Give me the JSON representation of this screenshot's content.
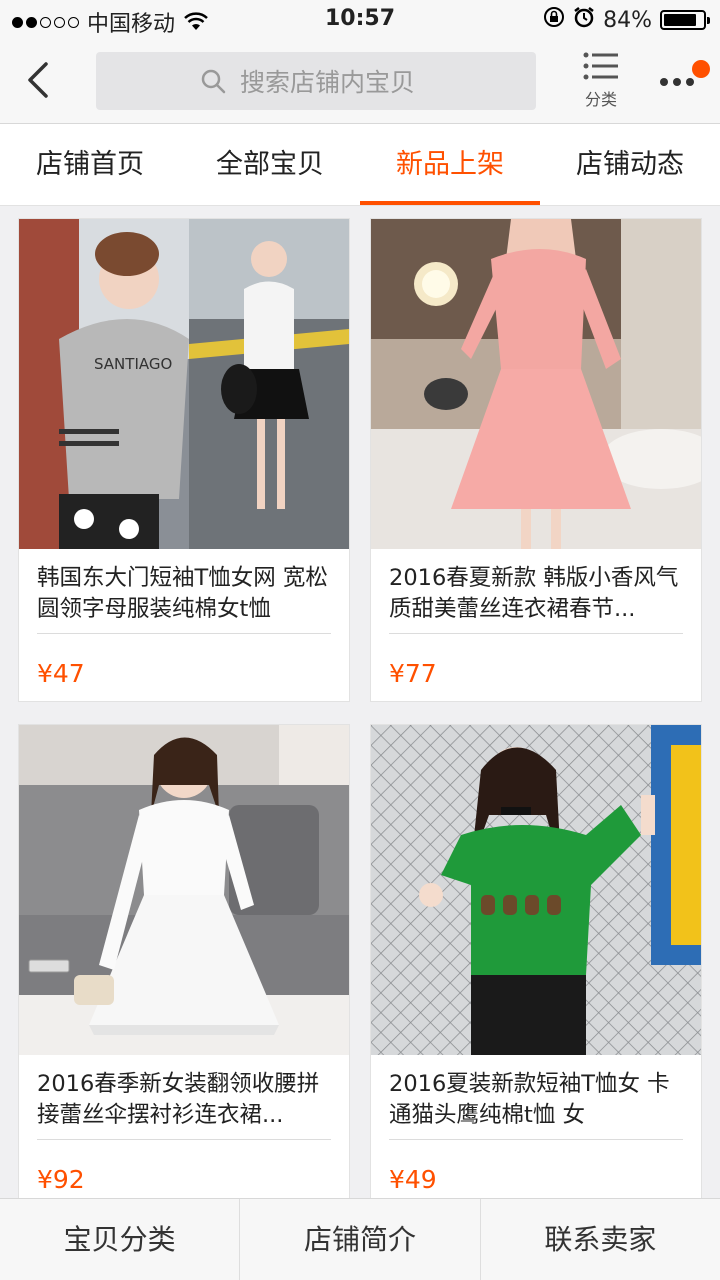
{
  "status_bar": {
    "carrier": "中国移动",
    "time": "10:57",
    "battery_percent": "84%",
    "battery_level": 0.84
  },
  "nav": {
    "search_placeholder": "搜索店铺内宝贝",
    "category_label": "分类",
    "accent_color": "#ff5000"
  },
  "tabs": [
    {
      "label": "店铺首页",
      "active": false
    },
    {
      "label": "全部宝贝",
      "active": false
    },
    {
      "label": "新品上架",
      "active": true
    },
    {
      "label": "店铺动态",
      "active": false
    }
  ],
  "products": [
    {
      "title": "韩国东大门短袖T恤女网 宽松圆领字母服装纯棉女t恤",
      "price": "¥47",
      "image": "model-grey-t-shirt-photo",
      "print": "SANTIAGO"
    },
    {
      "title": "2016春夏新款 韩版小香风气质甜美蕾丝连衣裙春节...",
      "price": "¥77",
      "image": "model-pink-lace-dress-photo"
    },
    {
      "title": "2016春季新女装翻领收腰拼接蕾丝伞摆衬衫连衣裙...",
      "price": "¥92",
      "image": "model-white-shirt-dress-photo"
    },
    {
      "title": "2016夏装新款短袖T恤女 卡通猫头鹰纯棉t恤 女",
      "price": "¥49",
      "image": "model-green-owl-t-shirt-photo"
    }
  ],
  "bottom_bar": [
    {
      "label": "宝贝分类"
    },
    {
      "label": "店铺简介"
    },
    {
      "label": "联系卖家"
    }
  ]
}
